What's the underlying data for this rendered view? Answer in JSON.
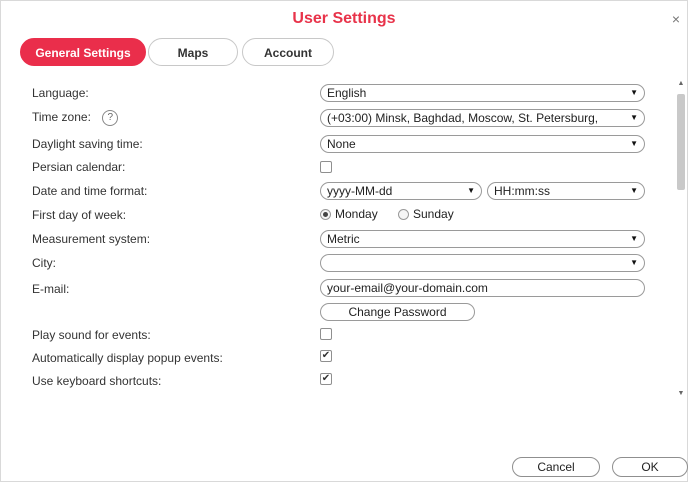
{
  "dialog": {
    "title": "User Settings",
    "close_glyph": "×"
  },
  "tabs": [
    {
      "label": "General Settings",
      "active": true
    },
    {
      "label": "Maps",
      "active": false
    },
    {
      "label": "Account",
      "active": false
    }
  ],
  "settings": {
    "language": {
      "label": "Language:",
      "value": "English"
    },
    "time_zone": {
      "label": "Time zone:",
      "help_glyph": "?",
      "value": "(+03:00) Minsk, Baghdad, Moscow, St. Petersburg,"
    },
    "daylight": {
      "label": "Daylight saving time:",
      "value": "None"
    },
    "persian_calendar": {
      "label": "Persian calendar:",
      "checked": false
    },
    "date_time_format": {
      "label": "Date and time format:",
      "date_value": "yyyy-MM-dd",
      "time_value": "HH:mm:ss"
    },
    "first_day": {
      "label": "First day of week:",
      "options": [
        "Monday",
        "Sunday"
      ],
      "selected": "Monday"
    },
    "measurement": {
      "label": "Measurement system:",
      "value": "Metric"
    },
    "city": {
      "label": "City:",
      "value": ""
    },
    "email": {
      "label": "E-mail:",
      "value": "your-email@your-domain.com"
    },
    "change_password_label": "Change Password",
    "play_sound": {
      "label": "Play sound for events:",
      "checked": false
    },
    "auto_popup": {
      "label": "Automatically display popup events:",
      "checked": true
    },
    "keyboard_shortcuts": {
      "label": "Use keyboard shortcuts:",
      "checked": true
    }
  },
  "glyphs": {
    "dropdown_arrow": "▼",
    "check": "✔",
    "scroll_up": "▲",
    "scroll_down": "▼"
  },
  "footer": {
    "cancel_label": "Cancel",
    "ok_label": "OK"
  },
  "colors": {
    "accent": "#ea2e4b",
    "title": "#e8334a"
  }
}
